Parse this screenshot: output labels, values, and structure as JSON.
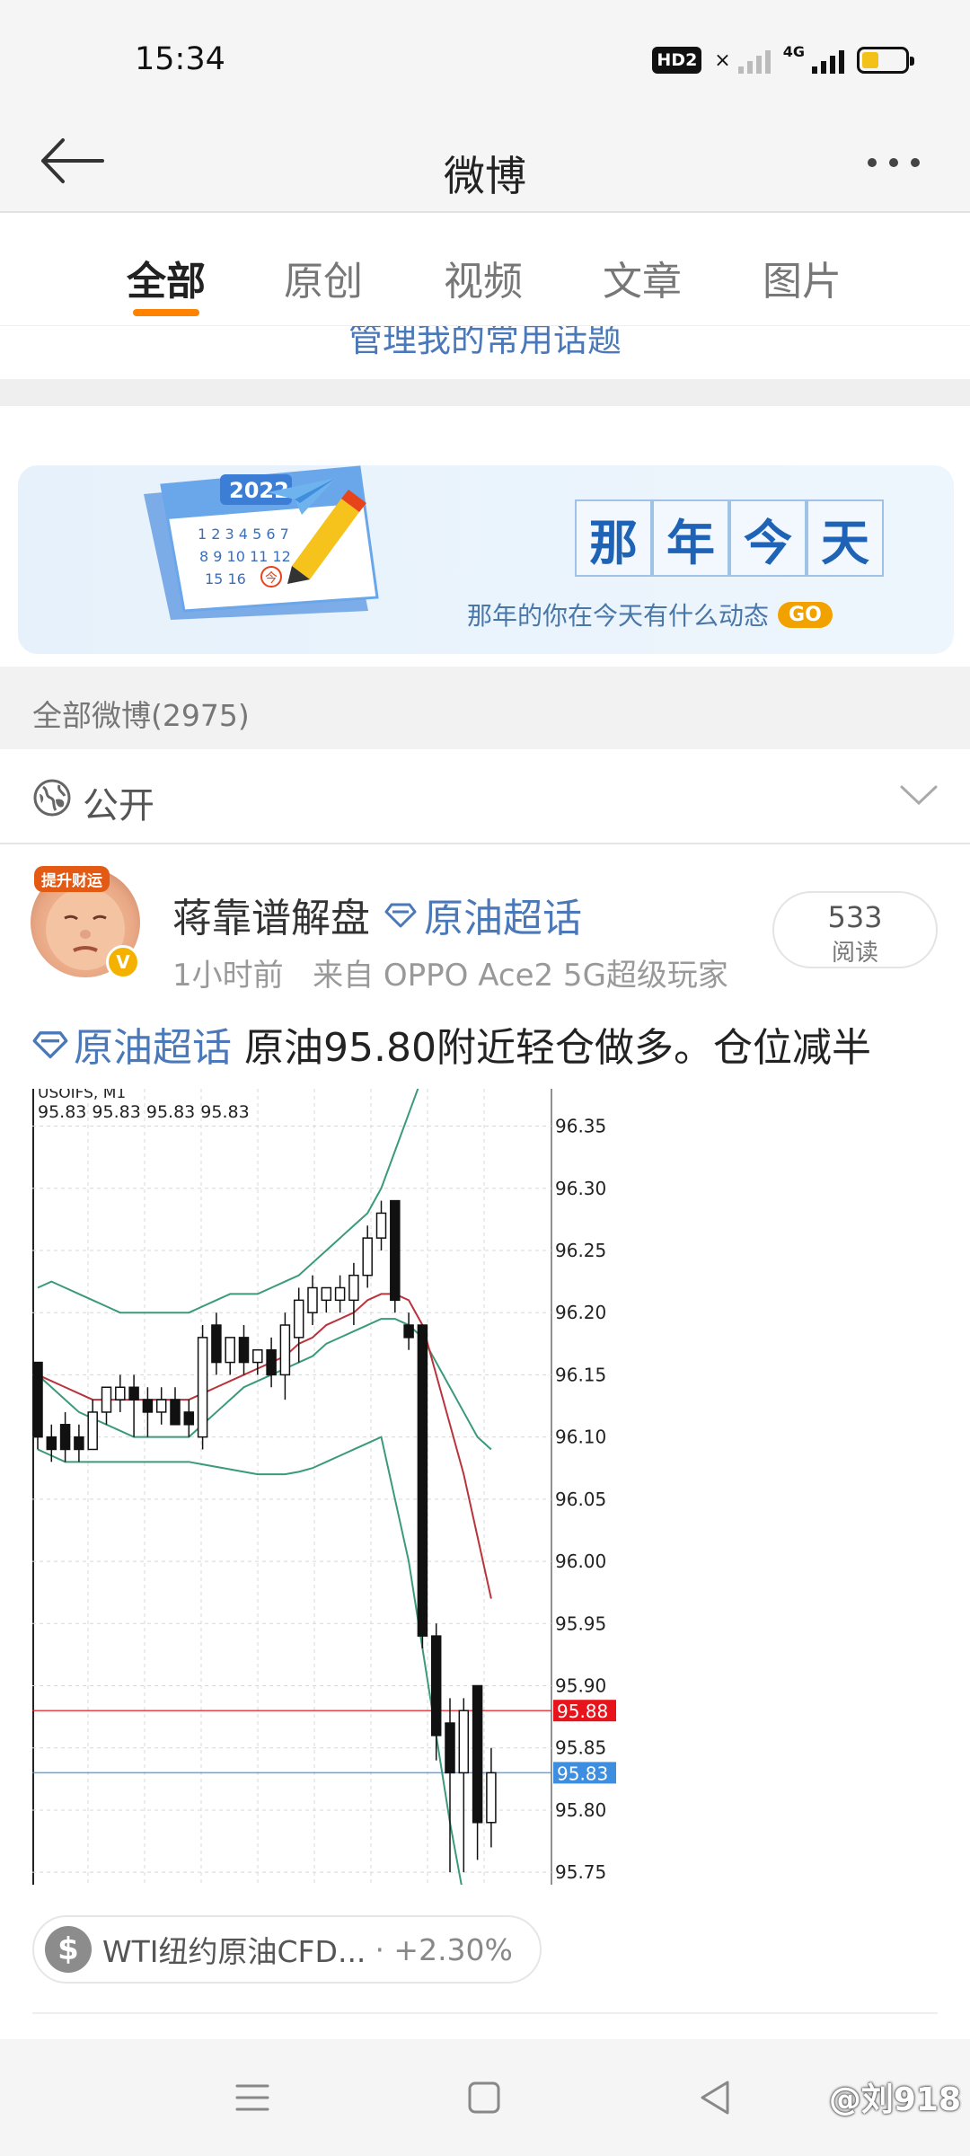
{
  "status_bar": {
    "time": "15:34",
    "hd": "HD2",
    "network": "4G",
    "battery_level": 0.4
  },
  "nav": {
    "title": "微博"
  },
  "tabs": [
    {
      "label": "全部",
      "active": true
    },
    {
      "label": "原创",
      "active": false
    },
    {
      "label": "视频",
      "active": false
    },
    {
      "label": "文章",
      "active": false
    },
    {
      "label": "图片",
      "active": false
    }
  ],
  "topic_link": "管理我的常用话题",
  "banner": {
    "year": "2022",
    "calendar_today": "今",
    "title_chars": [
      "那",
      "年",
      "今",
      "天"
    ],
    "subtitle": "那年的你在今天有什么动态",
    "go": "GO"
  },
  "count_label": "全部微博(2975)",
  "visibility": {
    "label": "公开"
  },
  "post": {
    "avatar_badge": "提升财运",
    "author": "蒋靠谱解盘",
    "topic": "原油超话",
    "time": "1小时前",
    "source": "来自 OPPO Ace2 5G超级玩家",
    "read_count": "533",
    "read_label": "阅读",
    "text_topic": "原油超话",
    "text": "原油95.80附近轻仓做多。仓位减半",
    "stock_name": "WTI纽约原油CFD...",
    "stock_change": "· +2.30%"
  },
  "chart_data": {
    "type": "candlestick",
    "symbol": "USOIFS, M1",
    "ohlc_readout": "95.83 95.83 95.83 95.83",
    "ylim": [
      95.74,
      96.38
    ],
    "y_ticks": [
      "96.35",
      "96.30",
      "96.25",
      "96.20",
      "96.15",
      "96.10",
      "96.05",
      "96.00",
      "95.95",
      "95.90",
      "95.85",
      "95.80",
      "95.75"
    ],
    "price_lines": [
      {
        "label": "95.88",
        "value": 95.88,
        "color": "#e8141c"
      },
      {
        "label": "95.83",
        "value": 95.83,
        "color": "#3d8de0"
      }
    ],
    "candles": [
      {
        "o": 96.16,
        "h": 96.16,
        "l": 96.09,
        "c": 96.1
      },
      {
        "o": 96.1,
        "h": 96.11,
        "l": 96.08,
        "c": 96.09
      },
      {
        "o": 96.11,
        "h": 96.12,
        "l": 96.08,
        "c": 96.09
      },
      {
        "o": 96.1,
        "h": 96.11,
        "l": 96.08,
        "c": 96.09
      },
      {
        "o": 96.09,
        "h": 96.13,
        "l": 96.09,
        "c": 96.12
      },
      {
        "o": 96.12,
        "h": 96.14,
        "l": 96.11,
        "c": 96.14
      },
      {
        "o": 96.13,
        "h": 96.15,
        "l": 96.12,
        "c": 96.14
      },
      {
        "o": 96.14,
        "h": 96.15,
        "l": 96.1,
        "c": 96.13
      },
      {
        "o": 96.13,
        "h": 96.14,
        "l": 96.1,
        "c": 96.12
      },
      {
        "o": 96.12,
        "h": 96.14,
        "l": 96.11,
        "c": 96.13
      },
      {
        "o": 96.13,
        "h": 96.14,
        "l": 96.11,
        "c": 96.11
      },
      {
        "o": 96.12,
        "h": 96.13,
        "l": 96.1,
        "c": 96.11
      },
      {
        "o": 96.1,
        "h": 96.19,
        "l": 96.09,
        "c": 96.18
      },
      {
        "o": 96.19,
        "h": 96.2,
        "l": 96.15,
        "c": 96.16
      },
      {
        "o": 96.16,
        "h": 96.18,
        "l": 96.15,
        "c": 96.18
      },
      {
        "o": 96.18,
        "h": 96.19,
        "l": 96.15,
        "c": 96.16
      },
      {
        "o": 96.16,
        "h": 96.17,
        "l": 96.15,
        "c": 96.17
      },
      {
        "o": 96.17,
        "h": 96.18,
        "l": 96.14,
        "c": 96.15
      },
      {
        "o": 96.15,
        "h": 96.2,
        "l": 96.13,
        "c": 96.19
      },
      {
        "o": 96.18,
        "h": 96.22,
        "l": 96.16,
        "c": 96.21
      },
      {
        "o": 96.2,
        "h": 96.23,
        "l": 96.19,
        "c": 96.22
      },
      {
        "o": 96.21,
        "h": 96.22,
        "l": 96.2,
        "c": 96.22
      },
      {
        "o": 96.21,
        "h": 96.23,
        "l": 96.2,
        "c": 96.22
      },
      {
        "o": 96.21,
        "h": 96.24,
        "l": 96.19,
        "c": 96.23
      },
      {
        "o": 96.23,
        "h": 96.27,
        "l": 96.22,
        "c": 96.26
      },
      {
        "o": 96.26,
        "h": 96.29,
        "l": 96.25,
        "c": 96.28
      },
      {
        "o": 96.29,
        "h": 96.29,
        "l": 96.2,
        "c": 96.21
      },
      {
        "o": 96.19,
        "h": 96.2,
        "l": 96.17,
        "c": 96.18
      },
      {
        "o": 96.19,
        "h": 96.19,
        "l": 95.93,
        "c": 95.94
      },
      {
        "o": 95.94,
        "h": 95.95,
        "l": 95.84,
        "c": 95.86
      },
      {
        "o": 95.87,
        "h": 95.89,
        "l": 95.75,
        "c": 95.83
      },
      {
        "o": 95.83,
        "h": 95.89,
        "l": 95.75,
        "c": 95.88
      },
      {
        "o": 95.9,
        "h": 95.9,
        "l": 95.76,
        "c": 95.79
      },
      {
        "o": 95.79,
        "h": 95.85,
        "l": 95.77,
        "c": 95.83
      }
    ],
    "ma_red": [
      96.15,
      96.145,
      96.14,
      96.135,
      96.13,
      96.13,
      96.13,
      96.13,
      96.13,
      96.13,
      96.13,
      96.13,
      96.135,
      96.14,
      96.145,
      96.15,
      96.155,
      96.16,
      96.165,
      96.175,
      96.18,
      96.19,
      96.195,
      96.2,
      96.21,
      96.215,
      96.215,
      96.21,
      96.19,
      96.15,
      96.11,
      96.07,
      96.02,
      95.97
    ],
    "band_upper": [
      96.22,
      96.225,
      96.22,
      96.215,
      96.21,
      96.205,
      96.2,
      96.2,
      96.2,
      96.2,
      96.2,
      96.2,
      96.205,
      96.21,
      96.215,
      96.215,
      96.215,
      96.22,
      96.225,
      96.23,
      96.24,
      96.25,
      96.26,
      96.27,
      96.28,
      96.3,
      96.33,
      96.36,
      96.39,
      96.42,
      96.45,
      96.48,
      96.51,
      96.54
    ],
    "band_lower": [
      96.15,
      96.14,
      96.13,
      96.12,
      96.115,
      96.11,
      96.105,
      96.1,
      96.1,
      96.1,
      96.1,
      96.1,
      96.11,
      96.12,
      96.13,
      96.14,
      96.145,
      96.15,
      96.155,
      96.16,
      96.165,
      96.175,
      96.18,
      96.185,
      96.19,
      96.195,
      96.195,
      96.19,
      96.18,
      96.16,
      96.14,
      96.12,
      96.1,
      96.09
    ],
    "band_lowest": [
      96.09,
      96.085,
      96.08,
      96.08,
      96.08,
      96.08,
      96.08,
      96.08,
      96.08,
      96.08,
      96.08,
      96.08,
      96.078,
      96.076,
      96.074,
      96.072,
      96.07,
      96.07,
      96.07,
      96.072,
      96.075,
      96.08,
      96.085,
      96.09,
      96.095,
      96.1,
      96.05,
      96.0,
      95.93,
      95.86,
      95.79,
      95.73,
      95.68,
      95.63
    ]
  }
}
